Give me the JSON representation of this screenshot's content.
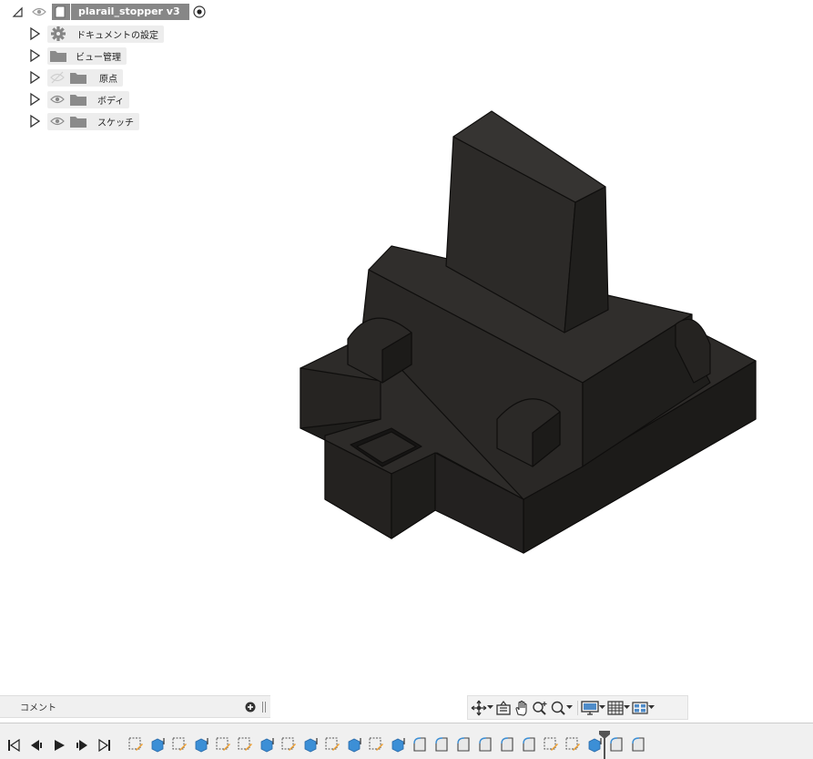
{
  "browser": {
    "root": {
      "name": "plarail_stopper v3"
    },
    "nodes": [
      {
        "label": "ドキュメントの設定",
        "icon": "gear-icon"
      },
      {
        "label": "ビュー管理",
        "icon": "folder-icon"
      },
      {
        "label": "原点",
        "icon": "folder-icon",
        "visibility": "hidden"
      },
      {
        "label": "ボディ",
        "icon": "folder-icon",
        "visibility": "visible"
      },
      {
        "label": "スケッチ",
        "icon": "folder-icon",
        "visibility": "visible"
      }
    ]
  },
  "comments": {
    "label": "コメント"
  },
  "navbar": {
    "items": [
      "orbit-icon",
      "look-at-icon",
      "pan-icon",
      "zoom-icon",
      "fit-icon",
      "display-settings-icon",
      "grid-settings-icon",
      "viewports-icon"
    ]
  },
  "timeline": {
    "controls": [
      "go-to-start-icon",
      "previous-step-icon",
      "play-icon",
      "next-step-icon",
      "go-to-end-icon"
    ],
    "features": [
      "sketch",
      "extrude",
      "sketch",
      "extrude",
      "sketch",
      "sketch",
      "extrude",
      "sketch",
      "extrude",
      "sketch",
      "extrude",
      "sketch",
      "extrude",
      "fillet",
      "fillet",
      "fillet",
      "fillet",
      "fillet",
      "fillet",
      "sketch",
      "sketch",
      "extrude",
      "fillet",
      "fillet"
    ]
  },
  "colors": {
    "model": "#252321",
    "edge": "#0e0d0c",
    "sketch_blue": "#3c8fd6",
    "sketch_orange": "#f0a030"
  }
}
